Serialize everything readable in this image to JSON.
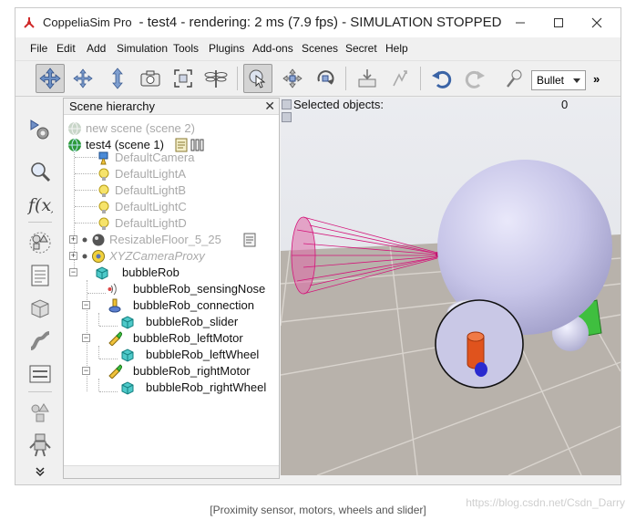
{
  "window": {
    "app_name": "CoppeliaSim Pro",
    "title": "- test4 - rendering: 2 ms (7.9 fps) - SIMULATION STOPPED"
  },
  "menu": [
    "File",
    "Edit",
    "Add",
    "Simulation",
    "Tools",
    "Plugins",
    "Add-ons",
    "Scenes",
    "Secret",
    "Help"
  ],
  "toolbar": {
    "physics_engine": "Bullet",
    "more": "»"
  },
  "hierarchy": {
    "title": "Scene hierarchy",
    "close": "✕",
    "scenes": [
      {
        "label": "new scene (scene 2)"
      },
      {
        "label": "test4 (scene 1)"
      }
    ],
    "items": [
      {
        "label": "DefaultCamera"
      },
      {
        "label": "DefaultLightA"
      },
      {
        "label": "DefaultLightB"
      },
      {
        "label": "DefaultLightC"
      },
      {
        "label": "DefaultLightD"
      },
      {
        "label": "ResizableFloor_5_25"
      },
      {
        "label": "XYZCameraProxy"
      },
      {
        "label": "bubbleRob"
      },
      {
        "label": "bubbleRob_sensingNose"
      },
      {
        "label": "bubbleRob_connection"
      },
      {
        "label": "bubbleRob_slider"
      },
      {
        "label": "bubbleRob_leftMotor"
      },
      {
        "label": "bubbleRob_leftWheel"
      },
      {
        "label": "bubbleRob_rightMotor"
      },
      {
        "label": "bubbleRob_rightWheel"
      }
    ]
  },
  "viewport": {
    "selected_label": "Selected objects:",
    "selected_count": "0"
  },
  "caption": "[Proximity sensor, motors, wheels and slider]",
  "watermark": "https://blog.csdn.net/Csdn_Darry",
  "colors": {
    "sensor_cone": "#d4157a",
    "robot_body": "#c9c7e9",
    "wheel_motor": "#e0531d",
    "green_part": "#3fbf3f",
    "floor": "#b9b3ad"
  }
}
